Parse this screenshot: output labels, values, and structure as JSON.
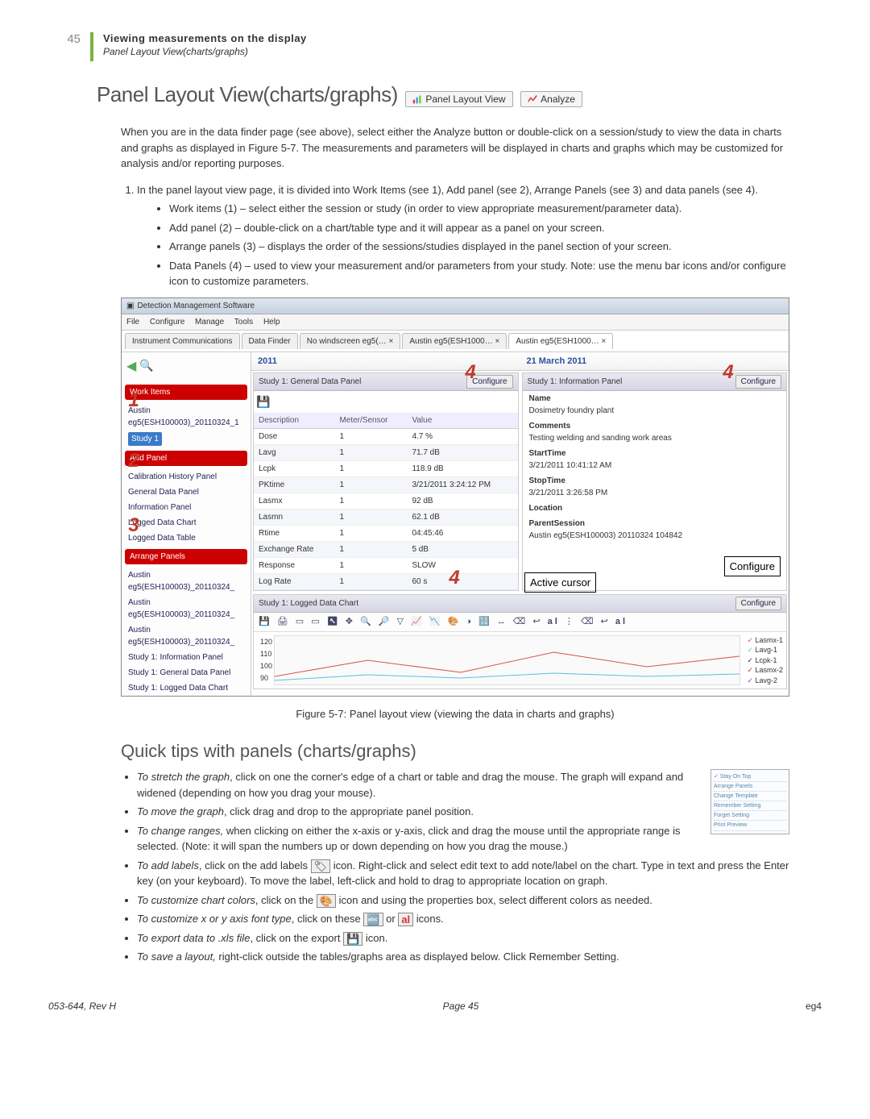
{
  "header": {
    "page_num_top": "45",
    "title": "Viewing measurements on the display",
    "subtitle": "Panel Layout View(charts/graphs)"
  },
  "h1": "Panel Layout View(charts/graphs)",
  "btn_panel_layout": "Panel Layout View",
  "btn_analyze": "Analyze",
  "intro_para": "When you are in the data finder page (see above), select either the Analyze button or double-click on a session/study to view the data in charts and graphs as displayed in Figure 5-7.  The measurements and parameters will be displayed in charts and graphs which may be customized for analysis and/or reporting purposes.",
  "step1_lead": "In the panel layout view page, it is divided into Work Items (see 1), Add panel (see 2), Arrange Panels (see 3) and data panels (see 4).",
  "bullets_main": [
    "Work items (1) – select either the session or study (in order to view appropriate measurement/parameter data).",
    "Add panel (2) – double-click on a chart/table type and it will appear as a panel on your screen.",
    "Arrange panels (3) – displays the order of the sessions/studies displayed in the panel section of your screen.",
    "Data Panels (4) – used to view your measurement and/or parameters from your study.  Note: use the menu bar icons and/or configure icon to customize parameters."
  ],
  "screenshot": {
    "window_title": "Detection Management Software",
    "menus": [
      "File",
      "Configure",
      "Manage",
      "Tools",
      "Help"
    ],
    "tabs": [
      "Instrument Communications",
      "Data Finder",
      "No windscreen eg5(…  ×",
      "Austin eg5(ESH1000…  ×",
      "Austin eg5(ESH1000…  ×"
    ],
    "date_left": "2011",
    "date_right": "21 March 2011",
    "sidebar": {
      "work_items_hdr": "Work Items",
      "work_item": "Austin eg5(ESH100003)_20110324_1",
      "work_item_sub": "Study 1",
      "add_panel_hdr": "Add Panel",
      "add_items": [
        "Calibration History Panel",
        "General Data Panel",
        "Information Panel",
        "Logged Data Chart",
        "Logged Data Table"
      ],
      "arrange_hdr": "Arrange Panels",
      "arrange_items": [
        "Austin eg5(ESH100003)_20110324_",
        "Austin eg5(ESH100003)_20110324_",
        "Austin eg5(ESH100003)_20110324_",
        "Study 1: Information Panel",
        "Study 1: General Data Panel",
        "Study 1: Logged Data Chart"
      ]
    },
    "panel_general": {
      "title": "Study 1: General Data Panel",
      "configure": "Configure",
      "cols": [
        "Description",
        "Meter/Sensor",
        "Value"
      ],
      "rows": [
        [
          "Dose",
          "1",
          "4.7 %"
        ],
        [
          "Lavg",
          "1",
          "71.7 dB"
        ],
        [
          "Lcpk",
          "1",
          "118.9 dB"
        ],
        [
          "PKtime",
          "1",
          "3/21/2011 3:24:12 PM"
        ],
        [
          "Lasmx",
          "1",
          "92 dB"
        ],
        [
          "Lasmn",
          "1",
          "62.1 dB"
        ],
        [
          "Rtime",
          "1",
          "04:45:46"
        ],
        [
          "Exchange Rate",
          "1",
          "5 dB"
        ],
        [
          "Response",
          "1",
          "SLOW"
        ],
        [
          "Log Rate",
          "1",
          "60 s"
        ]
      ]
    },
    "panel_info": {
      "title": "Study 1: Information Panel",
      "configure": "Configure",
      "fields": [
        [
          "Name",
          "Dosimetry foundry plant"
        ],
        [
          "Comments",
          "Testing welding and sanding work areas"
        ],
        [
          "StartTime",
          "3/21/2011 10:41:12 AM"
        ],
        [
          "StopTime",
          "3/21/2011 3:26:58 PM"
        ],
        [
          "Location",
          ""
        ],
        [
          "ParentSession",
          "Austin eg5(ESH100003) 20110324 104842"
        ]
      ]
    },
    "panel_chart": {
      "title": "Study 1: Logged Data Chart",
      "configure": "Configure",
      "y_ticks": [
        "120",
        "110",
        "100",
        "90"
      ],
      "legend": [
        "Lasmx-1",
        "Lavg-1",
        "Lcpk-1",
        "Lasmx-2",
        "Lavg-2"
      ]
    },
    "callout_active_cursor": "Active cursor",
    "callout_configure": "Configure"
  },
  "figure_caption": "Figure 5-7:  Panel layout view (viewing the data in charts and graphs)",
  "h2": "Quick tips with panels (charts/graphs)",
  "tips": {
    "t1a": "To stretch the graph",
    "t1b": ", click on one the corner's edge of a chart or table and drag the mouse.  The graph will expand and widened (depending on how you drag your mouse).",
    "t2a": "To move the graph",
    "t2b": ", click drag and drop to the appropriate panel position.",
    "t3a": "To change ranges,",
    "t3b": " when clicking on either the x-axis or y-axis, click and drag the mouse until the appropriate range is selected.  (Note:  it will span the numbers up or down depending on how you drag the mouse.)",
    "t4a": "To add labels",
    "t4b_pre": ", click on the add labels ",
    "t4b_post": " icon.  Right-click and select edit text to add note/label on the chart.  Type in text and press the Enter key (on your keyboard).    To move the label, left-click and hold to drag to appropriate location on graph.",
    "t5a": "To customize chart colors",
    "t5b_pre": ", click on the ",
    "t5b_post": " icon and using the properties box, select different colors as needed.",
    "t6a": "To customize x or y axis font type",
    "t6b_pre": ", click on these ",
    "t6b_mid": " or ",
    "t6b_post": " icons.",
    "t7a": "To export data to .xls file",
    "t7b_pre": ", click on the export ",
    "t7b_post": " icon.",
    "t8a": "To save a layout,",
    "t8b": " right-click outside the tables/graphs area as displayed below.  Click Remember Setting."
  },
  "context_menu": [
    "Stay On Top",
    "Arrange Panels",
    "Change Template",
    "Remember Setting",
    "Forget Setting",
    "Print Preview"
  ],
  "footer": {
    "left": "053-644, Rev H",
    "center": "Page   45",
    "right": "eg4"
  },
  "chart_data": {
    "type": "line",
    "title": "Study 1: Logged Data Chart",
    "ylabel": "",
    "xlabel": "",
    "ylim": [
      90,
      120
    ],
    "series": [
      {
        "name": "Lasmx-1",
        "color": "#d9534f"
      },
      {
        "name": "Lavg-1",
        "color": "#5bc0de"
      },
      {
        "name": "Lcpk-1",
        "color": "#333"
      },
      {
        "name": "Lasmx-2",
        "color": "#c0392b"
      },
      {
        "name": "Lavg-2",
        "color": "#8e44ad"
      }
    ],
    "note": "Exact time-series values not legible; chart shows multiple dB traces roughly between 90 and 120."
  }
}
